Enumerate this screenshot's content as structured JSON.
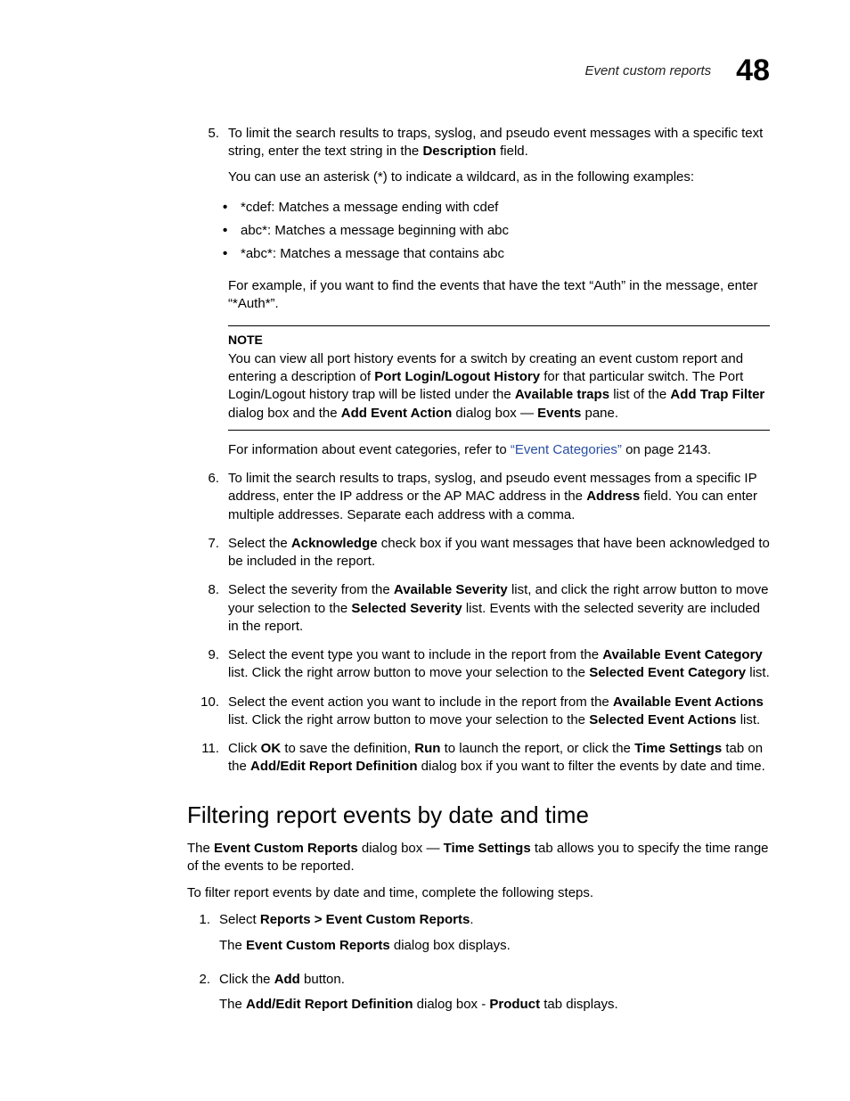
{
  "header": {
    "section": "Event custom reports",
    "chapter": "48"
  },
  "steps_a": [
    {
      "num": "5.",
      "paras": [
        [
          {
            "t": "To limit the search results to traps, syslog, and pseudo event messages with a specific text string, enter the text string in the "
          },
          {
            "t": "Description",
            "b": true
          },
          {
            "t": " field."
          }
        ],
        [
          {
            "t": "You can use an asterisk (*) to indicate a wildcard, as in the following examples:"
          }
        ]
      ],
      "bullets": [
        "*cdef: Matches a message ending with cdef",
        "abc*: Matches a message beginning with abc",
        "*abc*: Matches a message that contains abc"
      ],
      "after": [
        [
          {
            "t": "For example, if you want to find the events that have the text “Auth” in the message, enter “*Auth*”."
          }
        ]
      ]
    }
  ],
  "note": {
    "label": "NOTE",
    "runs": [
      {
        "t": "You can view all port history events for a switch by creating an event custom report and entering a description of "
      },
      {
        "t": "Port Login/Logout History",
        "b": true
      },
      {
        "t": " for that particular switch. The Port Login/Logout history trap will be listed under the "
      },
      {
        "t": "Available traps",
        "b": true
      },
      {
        "t": " list of the "
      },
      {
        "t": "Add Trap Filter",
        "b": true
      },
      {
        "t": " dialog box and the "
      },
      {
        "t": "Add Event Action",
        "b": true
      },
      {
        "t": " dialog box — "
      },
      {
        "t": "Events",
        "b": true
      },
      {
        "t": " pane."
      }
    ]
  },
  "after_note": [
    {
      "t": "For information about event categories, refer to "
    },
    {
      "t": "“Event Categories”",
      "link": true
    },
    {
      "t": " on page 2143."
    }
  ],
  "steps_b": [
    {
      "num": "6.",
      "runs": [
        {
          "t": "To limit the search results to traps, syslog, and pseudo event messages from a specific IP address, enter the IP address or the AP MAC address in the "
        },
        {
          "t": "Address",
          "b": true
        },
        {
          "t": " field. You can enter multiple addresses. Separate each address with a comma."
        }
      ]
    },
    {
      "num": "7.",
      "runs": [
        {
          "t": "Select the "
        },
        {
          "t": "Acknowledge",
          "b": true
        },
        {
          "t": " check box if you want messages that have been acknowledged to be included in the report."
        }
      ]
    },
    {
      "num": "8.",
      "runs": [
        {
          "t": "Select the severity from the "
        },
        {
          "t": "Available Severity",
          "b": true
        },
        {
          "t": " list, and click the right arrow button to move your selection to the "
        },
        {
          "t": "Selected Severity",
          "b": true
        },
        {
          "t": " list. Events with the selected severity are included in the report."
        }
      ]
    },
    {
      "num": "9.",
      "runs": [
        {
          "t": "Select the event type you want to include in the report from the "
        },
        {
          "t": "Available Event Category",
          "b": true
        },
        {
          "t": " list. Click the right arrow button to move your selection to the "
        },
        {
          "t": "Selected Event Category",
          "b": true
        },
        {
          "t": " list."
        }
      ]
    },
    {
      "num": "10.",
      "runs": [
        {
          "t": "Select the event action you want to include in the report from the "
        },
        {
          "t": "Available Event Actions",
          "b": true
        },
        {
          "t": " list. Click the right arrow button to move your selection to the "
        },
        {
          "t": "Selected Event Actions",
          "b": true
        },
        {
          "t": " list."
        }
      ]
    },
    {
      "num": "11.",
      "runs": [
        {
          "t": "Click "
        },
        {
          "t": "OK",
          "b": true
        },
        {
          "t": " to save the definition, "
        },
        {
          "t": "Run",
          "b": true
        },
        {
          "t": " to launch the report, or click the "
        },
        {
          "t": "Time Settings",
          "b": true
        },
        {
          "t": " tab on the "
        },
        {
          "t": "Add/Edit Report Definition",
          "b": true
        },
        {
          "t": " dialog box if you want to filter the events by date and time."
        }
      ]
    }
  ],
  "section": {
    "heading": "Filtering report events by date and time",
    "intro1": [
      {
        "t": "The "
      },
      {
        "t": "Event Custom Reports",
        "b": true
      },
      {
        "t": " dialog box — "
      },
      {
        "t": "Time Settings",
        "b": true
      },
      {
        "t": " tab allows you to specify the time range of the events to be reported."
      }
    ],
    "intro2": [
      {
        "t": "To filter report events by date and time, complete the following steps."
      }
    ],
    "steps": [
      {
        "num": "1.",
        "runs": [
          {
            "t": "Select "
          },
          {
            "t": "Reports > Event Custom Reports",
            "b": true
          },
          {
            "t": "."
          }
        ],
        "after": [
          {
            "t": "The "
          },
          {
            "t": "Event Custom Reports",
            "b": true
          },
          {
            "t": " dialog box displays."
          }
        ]
      },
      {
        "num": "2.",
        "runs": [
          {
            "t": "Click the "
          },
          {
            "t": "Add",
            "b": true
          },
          {
            "t": " button."
          }
        ],
        "after": [
          {
            "t": "The "
          },
          {
            "t": "Add/Edit Report Definition",
            "b": true
          },
          {
            "t": " dialog box - "
          },
          {
            "t": "Product",
            "b": true
          },
          {
            "t": " tab displays."
          }
        ]
      }
    ]
  }
}
